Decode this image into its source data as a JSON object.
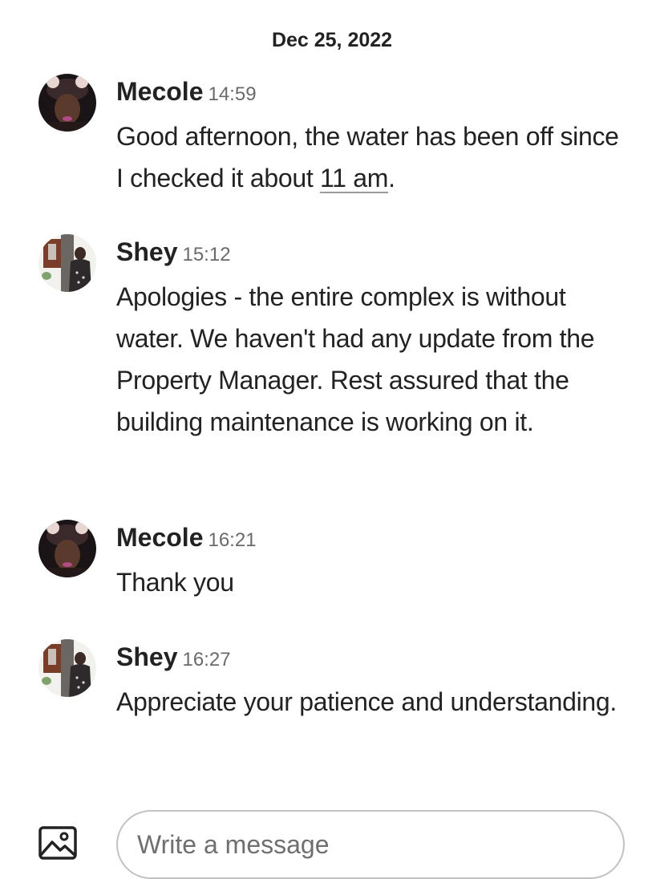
{
  "date_header": "Dec 25, 2022",
  "messages": [
    {
      "sender": "Mecole",
      "time": "14:59",
      "text_before": "Good afternoon, the water has been off since I checked it about ",
      "link_text": "11 am",
      "text_after": "."
    },
    {
      "sender": "Shey",
      "time": "15:12",
      "text": "Apologies - the entire complex is without water. We haven't had any update from the Property Manager. Rest assured that the building maintenance is working on it."
    },
    {
      "sender": "Mecole",
      "time": "16:21",
      "text": "Thank you"
    },
    {
      "sender": "Shey",
      "time": "16:27",
      "text": "Appreciate your patience and understanding."
    }
  ],
  "composer": {
    "placeholder": "Write a message"
  },
  "colors": {
    "text": "#222222",
    "timestamp": "#6a6a6a",
    "input_border": "#c2c2c2",
    "placeholder": "#6f6f6f"
  },
  "icons": {
    "composer_image": "image-icon",
    "avatar_mecole": "profile-photo",
    "avatar_shey": "profile-photo"
  }
}
